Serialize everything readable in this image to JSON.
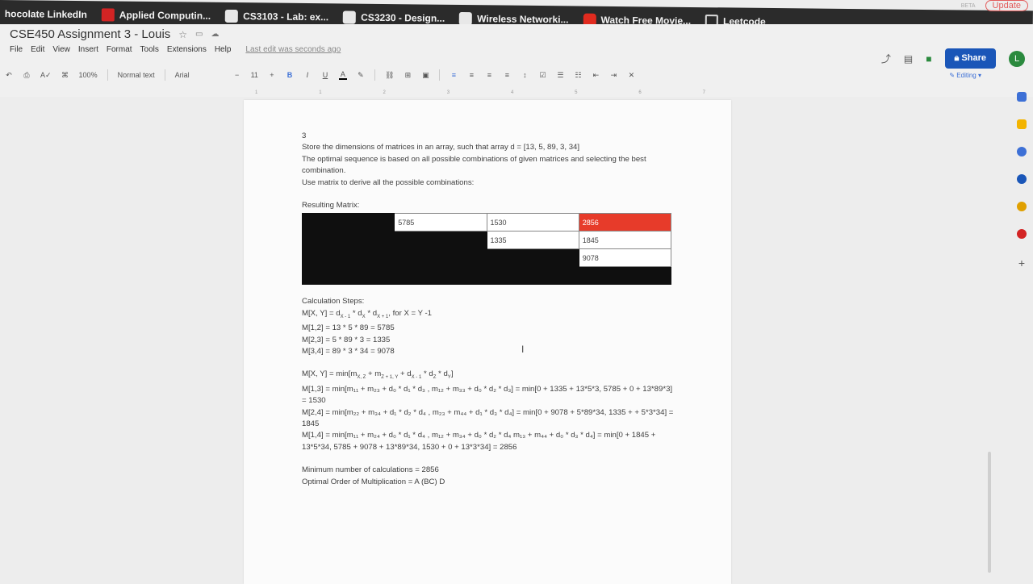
{
  "bookmarks": [
    {
      "label": "hocolate LinkedIn",
      "icon": "none"
    },
    {
      "label": "Applied Computin...",
      "icon": "red"
    },
    {
      "label": "CS3103 - Lab: ex...",
      "icon": "gh"
    },
    {
      "label": "CS3230 - Design...",
      "icon": "gh"
    },
    {
      "label": "Wireless Networki...",
      "icon": "gh"
    },
    {
      "label": "Watch Free Movie...",
      "icon": "yt"
    },
    {
      "label": "Leetcode",
      "icon": "folder"
    }
  ],
  "browser": {
    "update_label": "Update",
    "beta_label": "BETA",
    "profile_initial": "L"
  },
  "doc": {
    "title": "CSE450 Assignment 3 - Louis",
    "menu": [
      "File",
      "Edit",
      "View",
      "Insert",
      "Format",
      "Tools",
      "Extensions",
      "Help"
    ],
    "last_edit": "Last edit was seconds ago",
    "share_label": "Share",
    "avatar_initial": "L",
    "editing_label": "Editing"
  },
  "toolbar": {
    "zoom": "100%",
    "style": "Normal text",
    "font": "Arial",
    "font_size": "11",
    "minus": "−",
    "plus": "+",
    "bold": "B",
    "italic": "I",
    "underline": "U",
    "text_color": "A"
  },
  "ruler": {
    "marks": [
      "1",
      "1",
      "2",
      "3",
      "4",
      "5",
      "6",
      "7"
    ]
  },
  "content": {
    "heading": "3",
    "intro_1": "Store the dimensions of matrices in an array, such that array d = [13, 5, 89, 3, 34]",
    "intro_2": "The optimal sequence is based on all possible combinations of given matrices and selecting the best combination.",
    "intro_3": "Use matrix to derive all the possible combinations:",
    "resulting_label": "Resulting Matrix:",
    "matrix": {
      "row1": [
        "5785",
        "1530",
        "2856"
      ],
      "row2": [
        "1335",
        "1845"
      ],
      "row3": [
        "9078"
      ]
    },
    "calc_label": "Calculation Steps:",
    "formula_main": "M[X, Y] = d",
    "formula_sub1": "X - 1",
    "formula_mid1": " * d",
    "formula_sub2": "X",
    "formula_mid2": " * d",
    "formula_sub3": "X + 1",
    "formula_tail": ", for X = Y -1",
    "m12": "M[1,2] = 13 * 5 * 89 = 5785",
    "m23": "M[2,3] = 5 * 89 * 3 = 1335",
    "m34": "M[3,4] = 89 * 3 * 34 = 9078",
    "general": "M[X, Y] = min[m",
    "general_sub1": "X, Z",
    "general_mid": " + m",
    "general_sub2": "Z + 1, Y",
    "general_mid2": " + d",
    "general_sub3": "X - 1",
    "general_mid3": " * d",
    "general_sub4": "Z",
    "general_mid4": " * d",
    "general_sub5": "Y",
    "general_tail": "]",
    "m13": "M[1,3] = min[m₁₁ + m₂₃ + d₀ * d₁ * d₃ , m₁₂ + m₃₃ + d₀ * d₂ * d₃] = min[0 + 1335 + 13*5*3, 5785 + 0 + 13*89*3] = 1530",
    "m24": "M[2,4] = min[m₂₂ + m₃₄ + d₁ * d₂ * d₄ , m₂₃ + m₄₄ + d₁ * d₃ * d₄] = min[0 + 9078 + 5*89*34, 1335 + + 5*3*34] = 1845",
    "m14": "M[1,4] = min[m₁₁ + m₂₄ + d₀ * d₁ * d₄ , m₁₂ + m₃₄ + d₀ * d₂ * d₄ m₁₃ + m₄₄ + d₀ * d₃ * d₄] = min[0 + 1845 + 13*5*34, 5785 + 9078 + 13*89*34, 1530 + 0 + 13*3*34] = 2856",
    "min_calc": "Minimum number of calculations = 2856",
    "optimal_order": "Optimal Order of Multiplication = A (BC) D"
  },
  "colors": {
    "accent_blue": "#1a56b8",
    "highlight_red": "#e73b2a",
    "page_bg": "#fbfbfb"
  },
  "icons": [
    "star-icon",
    "move-to-folder-icon",
    "cloud-status-icon",
    "activity-icon",
    "comments-icon",
    "meet-icon",
    "lock-icon",
    "pencil-icon",
    "text-cursor-icon"
  ]
}
